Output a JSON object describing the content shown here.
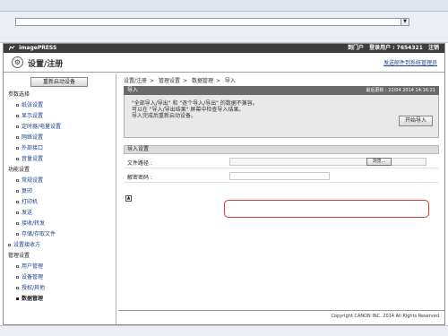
{
  "header": {
    "product": "imagePRESS",
    "portal_link": "到门户",
    "user_label": "登录用户 : 7654321",
    "logout_link": "注销"
  },
  "title": {
    "text": "设置/注册",
    "icon": "gear-icon",
    "right_link": "发送邮件到系统管理员"
  },
  "sidebar": {
    "reboot_button": "重新启动设备",
    "groups": [
      {
        "label": "参数选择",
        "items": [
          "纸张设置",
          "显示设置",
          "定时器/电量设置",
          "网络设置",
          "外部接口",
          "音量设置"
        ]
      },
      {
        "label": "功能设置",
        "items": [
          "常规设置",
          "复印",
          "打印机",
          "发送",
          "接收/转发",
          "存储/存取文件"
        ]
      }
    ],
    "receiver": "设置接收方",
    "mgmt_group": "管理设置",
    "mgmt_items": [
      "用户管理",
      "设备管理",
      "授权/其他",
      "数据管理"
    ],
    "active_item": "数据管理"
  },
  "main": {
    "breadcrumb": [
      "设置/注册",
      "管理设置",
      "数据管理",
      "导入"
    ],
    "panel_title": "导入",
    "last_update": "最后更新 : 22/04 2014 14:16:21",
    "info_lines": [
      "\"全部导入/导出\" 和 \"逐个导入/导出\" 的数据不兼容。",
      "可以在 \"导入/导出结果\" 屏幕中检查导入结果。",
      "导入完成后重新启动设备。"
    ],
    "start_import_button": "开始导入",
    "section_title": "导入设置",
    "file_path_label": "文件路径 :",
    "browse_button": "浏览...",
    "password_label": "解密密码 :"
  },
  "footer": {
    "copyright": "Copyright CANON INC. 2014 All Rights Reserved"
  },
  "colors": {
    "header_bg": "#3d3d3d",
    "link": "#1c3f86",
    "highlight": "#d33a3a"
  }
}
